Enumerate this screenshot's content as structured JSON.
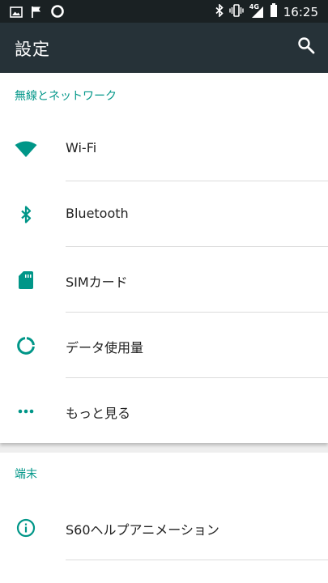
{
  "status_bar": {
    "time": "16:25",
    "network_type": "4G",
    "icons": [
      "image-icon",
      "flag-icon",
      "ring-icon",
      "bluetooth-icon",
      "vibrate-icon",
      "signal-icon",
      "battery-icon"
    ]
  },
  "app_bar": {
    "title": "設定",
    "search_icon": "search-icon",
    "color": "#263238"
  },
  "accent_color": "#009688",
  "sections": [
    {
      "header": "無線とネットワーク",
      "items": [
        {
          "label": "Wi-Fi",
          "icon": "wifi-icon"
        },
        {
          "label": "Bluetooth",
          "icon": "bluetooth-icon"
        },
        {
          "label": "SIMカード",
          "icon": "sim-card-icon"
        },
        {
          "label": "データ使用量",
          "icon": "data-usage-icon"
        },
        {
          "label": "もっと見る",
          "icon": "more-icon"
        }
      ]
    },
    {
      "header": "端末",
      "items": [
        {
          "label": "S60ヘルプアニメーション",
          "icon": "info-icon"
        }
      ]
    }
  ]
}
